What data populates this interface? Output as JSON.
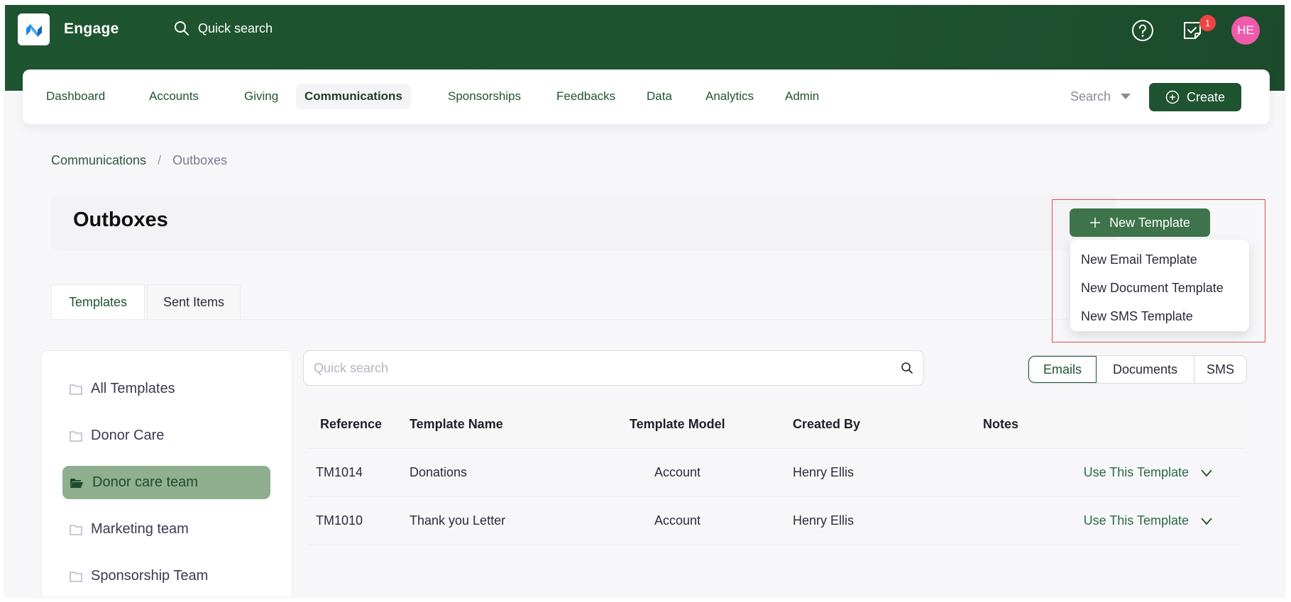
{
  "app": {
    "name": "Engage",
    "quick_search_label": "Quick search",
    "notification_count": "1",
    "user_initials": "HE"
  },
  "nav": {
    "items": [
      {
        "label": "Dashboard",
        "active": false
      },
      {
        "label": "Accounts",
        "active": false
      },
      {
        "label": "Giving",
        "active": false
      },
      {
        "label": "Communications",
        "active": true
      },
      {
        "label": "Sponsorships",
        "active": false
      },
      {
        "label": "Feedbacks",
        "active": false
      },
      {
        "label": "Data",
        "active": false
      },
      {
        "label": "Analytics",
        "active": false
      },
      {
        "label": "Admin",
        "active": false
      }
    ],
    "search_label": "Search",
    "create_label": "Create"
  },
  "breadcrumb": {
    "parent": "Communications",
    "separator": "/",
    "current": "Outboxes"
  },
  "page": {
    "title": "Outboxes",
    "new_template_label": "New Template",
    "new_template_menu": [
      "New Email Template",
      "New Document Template",
      "New SMS Template"
    ]
  },
  "tabs": [
    {
      "label": "Templates",
      "active": true
    },
    {
      "label": "Sent Items",
      "active": false
    }
  ],
  "folders": [
    {
      "label": "All Templates",
      "active": false
    },
    {
      "label": "Donor Care",
      "active": false
    },
    {
      "label": "Donor care team",
      "active": true
    },
    {
      "label": "Marketing team",
      "active": false
    },
    {
      "label": "Sponsorship Team",
      "active": false
    }
  ],
  "search": {
    "placeholder": "Quick search",
    "value": ""
  },
  "type_filter": {
    "options": [
      "Emails",
      "Documents",
      "SMS"
    ],
    "selected": "Emails"
  },
  "table": {
    "columns": [
      "Reference",
      "Template Name",
      "Template Model",
      "Created By",
      "Notes"
    ],
    "rows": [
      {
        "reference": "TM1014",
        "name": "Donations",
        "model": "Account",
        "created_by": "Henry Ellis",
        "notes": "",
        "action": "Use This Template"
      },
      {
        "reference": "TM1010",
        "name": "Thank you Letter",
        "model": "Account",
        "created_by": "Henry Ellis",
        "notes": "",
        "action": "Use This Template"
      }
    ]
  },
  "colors": {
    "brand_green": "#1f5430",
    "button_green": "#3e744b",
    "active_folder": "#8faf8f",
    "badge_red": "#ef4444",
    "avatar_pink": "#f05aaa",
    "highlight_border": "#e24a4a"
  }
}
